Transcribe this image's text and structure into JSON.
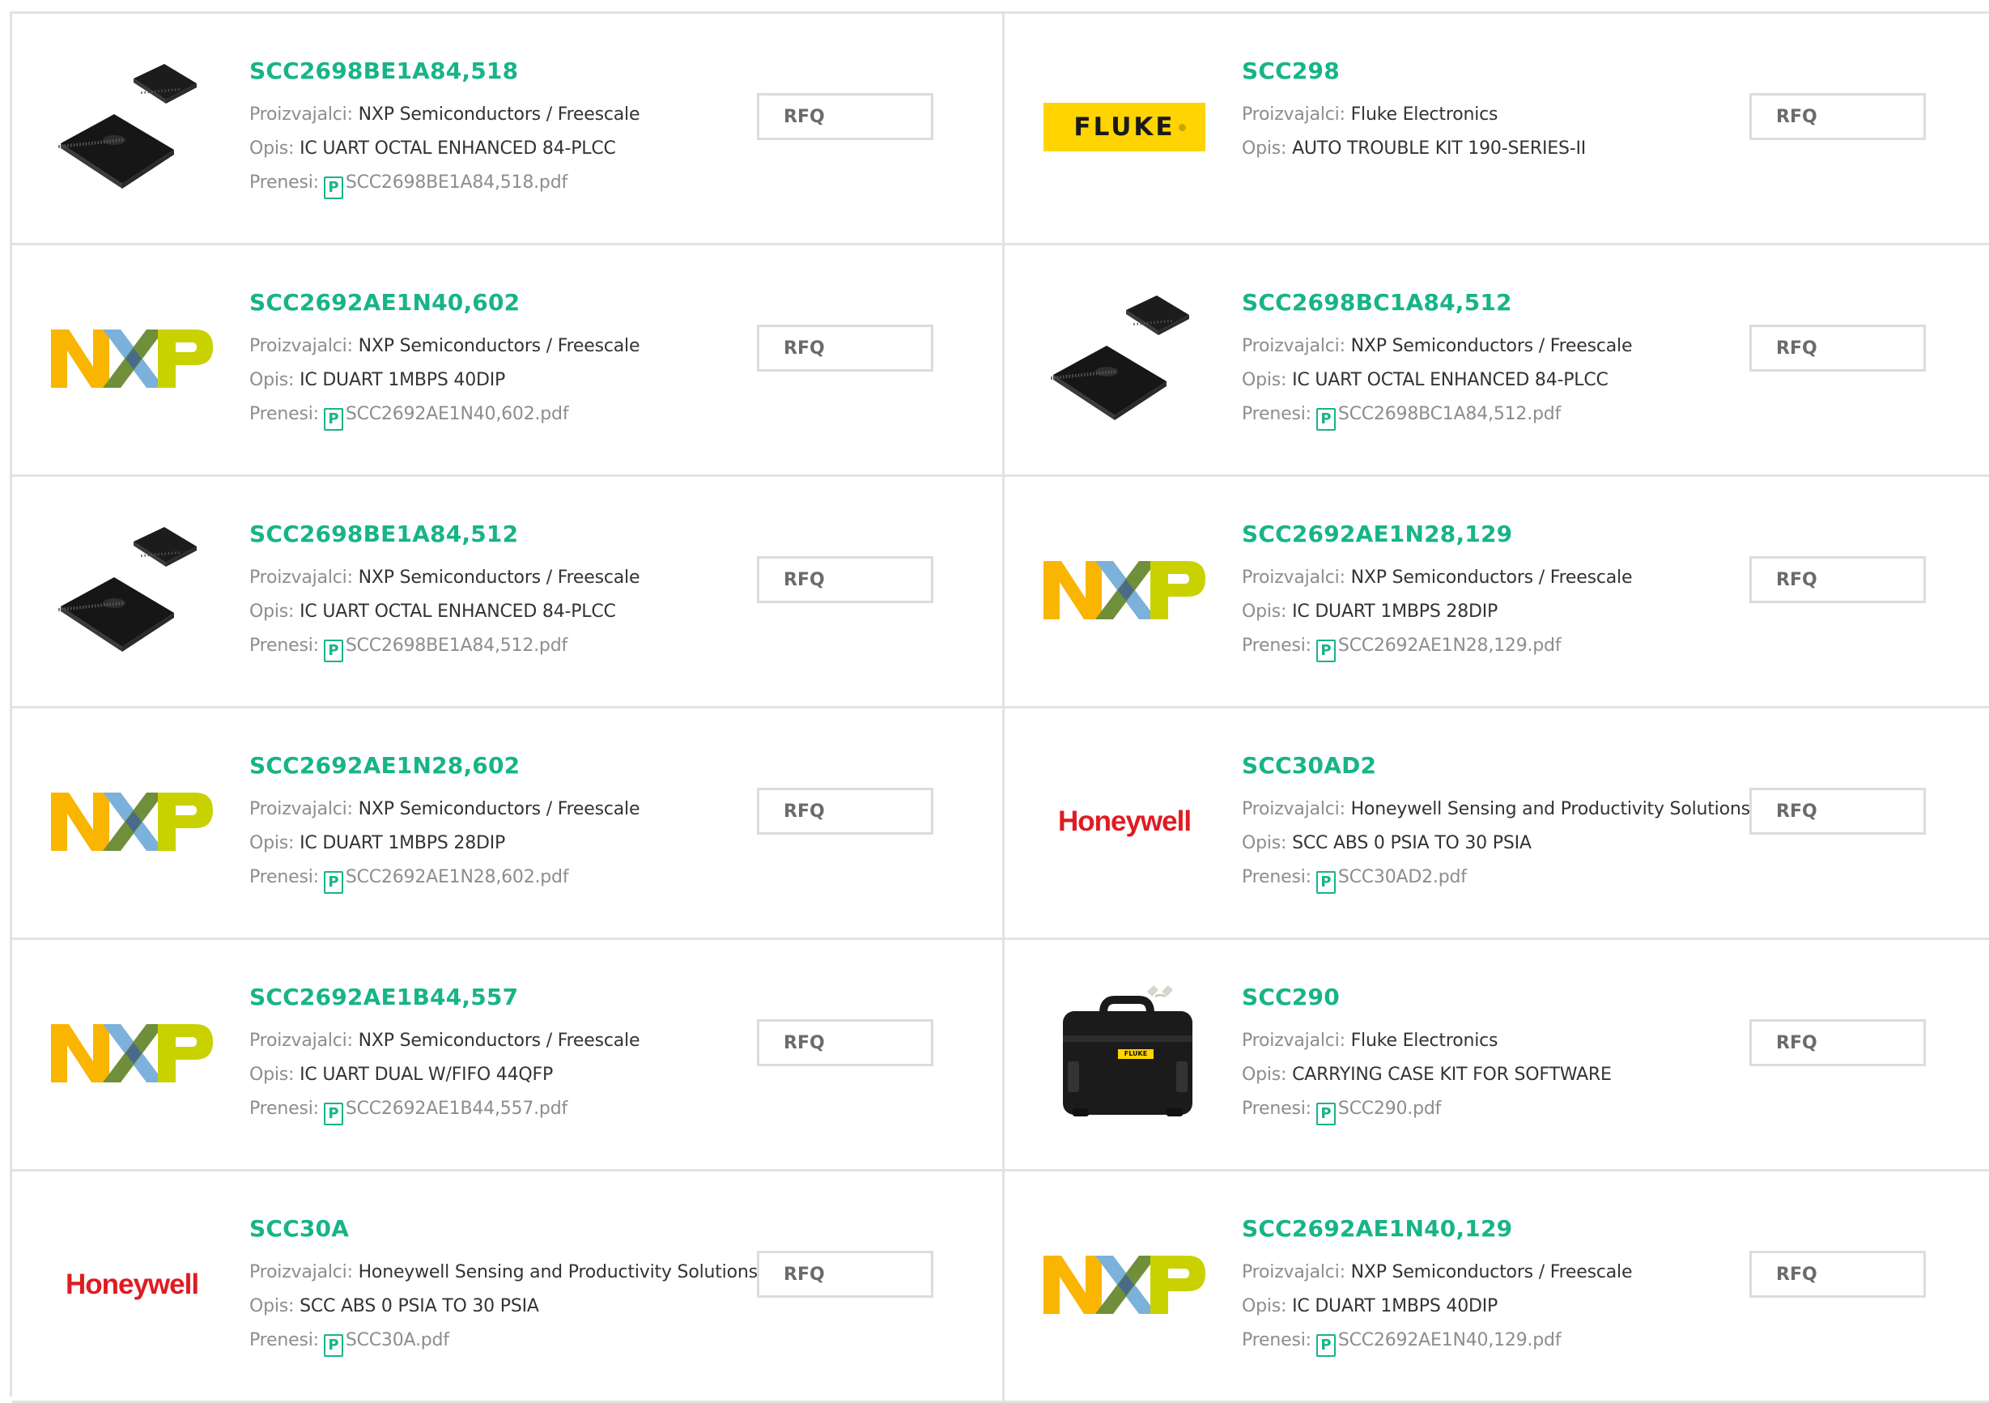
{
  "labels": {
    "manufacturer": "Proizvajalci:",
    "description": "Opis:",
    "download": "Prenesi:",
    "rfq": "RFQ",
    "pdf_glyph": "P"
  },
  "colors": {
    "accent": "#17b487",
    "label": "#8d8d8d",
    "text": "#333333",
    "border": "#e2e2e2",
    "fluke_yellow": "#ffd400",
    "honeywell_red": "#e01b22"
  },
  "logos": {
    "fluke": "FLUKE",
    "honeywell": "Honeywell",
    "fluke_case_label": "FLUKE"
  },
  "products": [
    {
      "name": "SCC2698BE1A84,518",
      "manufacturer": "NXP Semiconductors / Freescale",
      "description": "IC UART OCTAL ENHANCED 84-PLCC",
      "file": "SCC2698BE1A84,518.pdf",
      "image": "ic-chip"
    },
    {
      "name": "SCC298",
      "manufacturer": "Fluke Electronics",
      "description": "AUTO TROUBLE KIT 190-SERIES-II",
      "file": "",
      "image": "fluke-logo"
    },
    {
      "name": "SCC2692AE1N40,602",
      "manufacturer": "NXP Semiconductors / Freescale",
      "description": "IC DUART 1MBPS 40DIP",
      "file": "SCC2692AE1N40,602.pdf",
      "image": "nxp-logo"
    },
    {
      "name": "SCC2698BC1A84,512",
      "manufacturer": "NXP Semiconductors / Freescale",
      "description": "IC UART OCTAL ENHANCED 84-PLCC",
      "file": "SCC2698BC1A84,512.pdf",
      "image": "ic-chip"
    },
    {
      "name": "SCC2698BE1A84,512",
      "manufacturer": "NXP Semiconductors / Freescale",
      "description": "IC UART OCTAL ENHANCED 84-PLCC",
      "file": "SCC2698BE1A84,512.pdf",
      "image": "ic-chip"
    },
    {
      "name": "SCC2692AE1N28,129",
      "manufacturer": "NXP Semiconductors / Freescale",
      "description": "IC DUART 1MBPS 28DIP",
      "file": "SCC2692AE1N28,129.pdf",
      "image": "nxp-logo"
    },
    {
      "name": "SCC2692AE1N28,602",
      "manufacturer": "NXP Semiconductors / Freescale",
      "description": "IC DUART 1MBPS 28DIP",
      "file": "SCC2692AE1N28,602.pdf",
      "image": "nxp-logo"
    },
    {
      "name": "SCC30AD2",
      "manufacturer": "Honeywell Sensing and Productivity Solutions",
      "description": "SCC ABS 0 PSIA TO 30 PSIA",
      "file": "SCC30AD2.pdf",
      "image": "honeywell-logo"
    },
    {
      "name": "SCC2692AE1B44,557",
      "manufacturer": "NXP Semiconductors / Freescale",
      "description": "IC UART DUAL W/FIFO 44QFP",
      "file": "SCC2692AE1B44,557.pdf",
      "image": "nxp-logo"
    },
    {
      "name": "SCC290",
      "manufacturer": "Fluke Electronics",
      "description": "CARRYING CASE KIT FOR SOFTWARE",
      "file": "SCC290.pdf",
      "image": "carrying-case"
    },
    {
      "name": "SCC30A",
      "manufacturer": "Honeywell Sensing and Productivity Solutions",
      "description": "SCC ABS 0 PSIA TO 30 PSIA",
      "file": "SCC30A.pdf",
      "image": "honeywell-logo"
    },
    {
      "name": "SCC2692AE1N40,129",
      "manufacturer": "NXP Semiconductors / Freescale",
      "description": "IC DUART 1MBPS 40DIP",
      "file": "SCC2692AE1N40,129.pdf",
      "image": "nxp-logo"
    }
  ]
}
